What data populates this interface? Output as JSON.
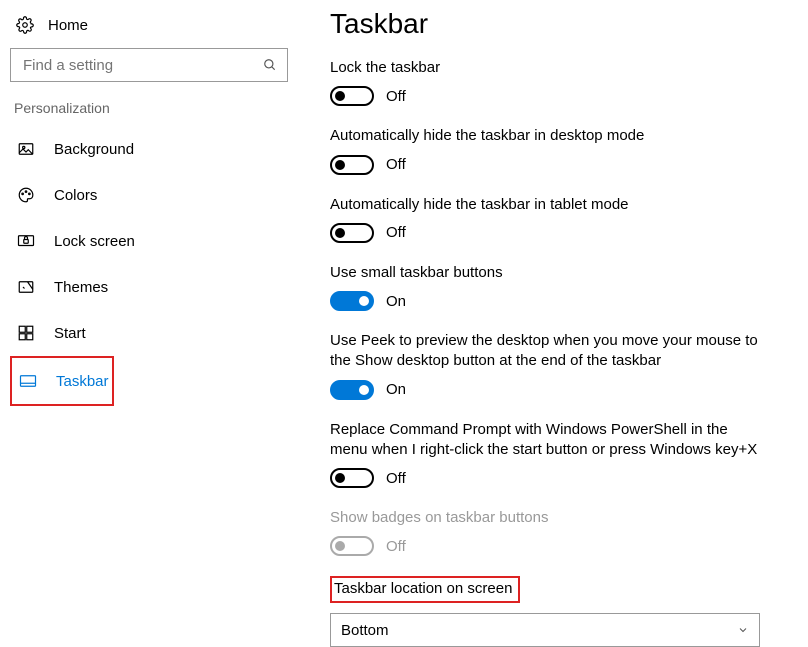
{
  "sidebar": {
    "home": "Home",
    "search_placeholder": "Find a setting",
    "section": "Personalization",
    "items": [
      {
        "label": "Background"
      },
      {
        "label": "Colors"
      },
      {
        "label": "Lock screen"
      },
      {
        "label": "Themes"
      },
      {
        "label": "Start"
      },
      {
        "label": "Taskbar"
      }
    ]
  },
  "main": {
    "title": "Taskbar",
    "toggles": {
      "lock": {
        "label": "Lock the taskbar",
        "state": "Off"
      },
      "hide_desktop": {
        "label": "Automatically hide the taskbar in desktop mode",
        "state": "Off"
      },
      "hide_tablet": {
        "label": "Automatically hide the taskbar in tablet mode",
        "state": "Off"
      },
      "small_buttons": {
        "label": "Use small taskbar buttons",
        "state": "On"
      },
      "peek": {
        "label": "Use Peek to preview the desktop when you move your mouse to the Show desktop button at the end of the taskbar",
        "state": "On"
      },
      "powershell": {
        "label": "Replace Command Prompt with Windows PowerShell in the menu when I right-click the start button or press Windows key+X",
        "state": "Off"
      },
      "badges": {
        "label": "Show badges on taskbar buttons",
        "state": "Off"
      }
    },
    "location": {
      "title": "Taskbar location on screen",
      "value": "Bottom"
    }
  }
}
